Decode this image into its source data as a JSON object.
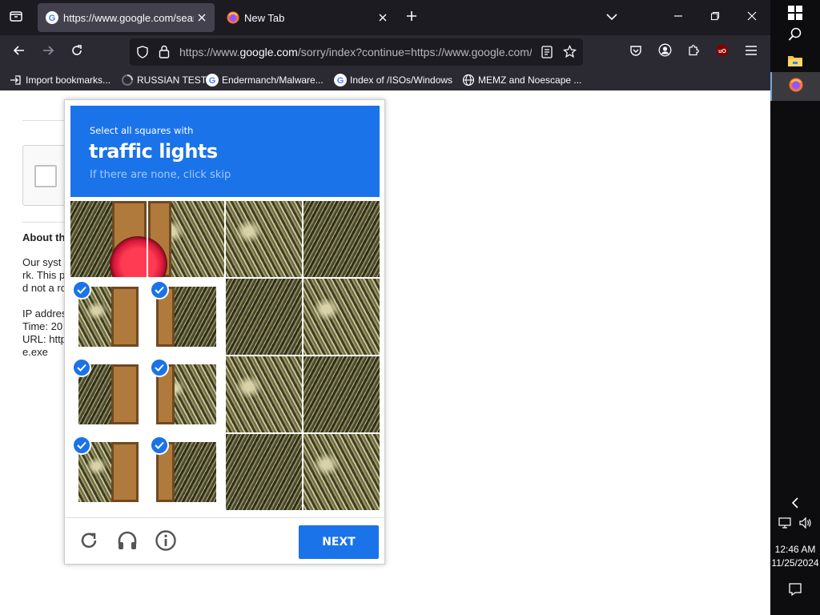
{
  "browser": {
    "tabs": [
      {
        "title": "https://www.google.com/search",
        "active": true
      },
      {
        "title": "New Tab",
        "active": false
      }
    ],
    "url": {
      "prefix": "https://www.",
      "domain": "google.com",
      "path": "/sorry/index?continue=https://www.google.com/"
    },
    "bookmarks": [
      {
        "label": "Import bookmarks...",
        "icon": "import-icon"
      },
      {
        "label": "RUSSIAN TEST",
        "icon": "loading-icon"
      },
      {
        "label": "Endermanch/Malware...",
        "icon": "google-icon"
      },
      {
        "label": "Index of /ISOs/Windows",
        "icon": "google-icon"
      },
      {
        "label": "MEMZ and Noescape ...",
        "icon": "globe-icon"
      }
    ]
  },
  "page": {
    "about_heading": "About th",
    "lines": [
      "Our syst",
      "rk. This p",
      "d not a ro",
      "",
      "IP addres",
      "Time: 20",
      "URL: http",
      "e.exe"
    ]
  },
  "captcha": {
    "instruction": "Select all squares with",
    "target": "traffic lights",
    "hint": "If there are none, click skip",
    "next_label": "NEXT",
    "selected_cells": [
      4,
      5,
      8,
      9,
      12,
      13
    ],
    "colors": {
      "accent": "#1a73e8"
    }
  },
  "taskbar": {
    "time": "12:46 AM",
    "date": "11/25/2024"
  }
}
